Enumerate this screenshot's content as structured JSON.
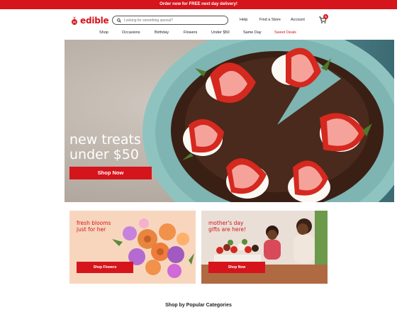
{
  "promo": {
    "text": "Order now for FREE next day delivery!"
  },
  "header": {
    "logo_text": "edible",
    "search_placeholder": "Looking for something special?",
    "help": "Help",
    "find_store": "Find a Store",
    "account": "Account",
    "cart_count": "0"
  },
  "nav": {
    "items": [
      "Shop",
      "Occasions",
      "Birthday",
      "Flowers",
      "Under $50",
      "Same Day",
      "Sweet Deals"
    ]
  },
  "hero": {
    "line1": "new treats",
    "line2": "under $50",
    "button": "Shop Now"
  },
  "cards": [
    {
      "line1": "fresh blooms",
      "line2": "just for her",
      "button": "Shop Flowers"
    },
    {
      "line1": "mother's day",
      "line2": "gifts are here!",
      "button": "Shop Now"
    }
  ],
  "sections": {
    "categories_title": "Shop by Popular Categories"
  },
  "colors": {
    "brand": "#d5141c"
  }
}
